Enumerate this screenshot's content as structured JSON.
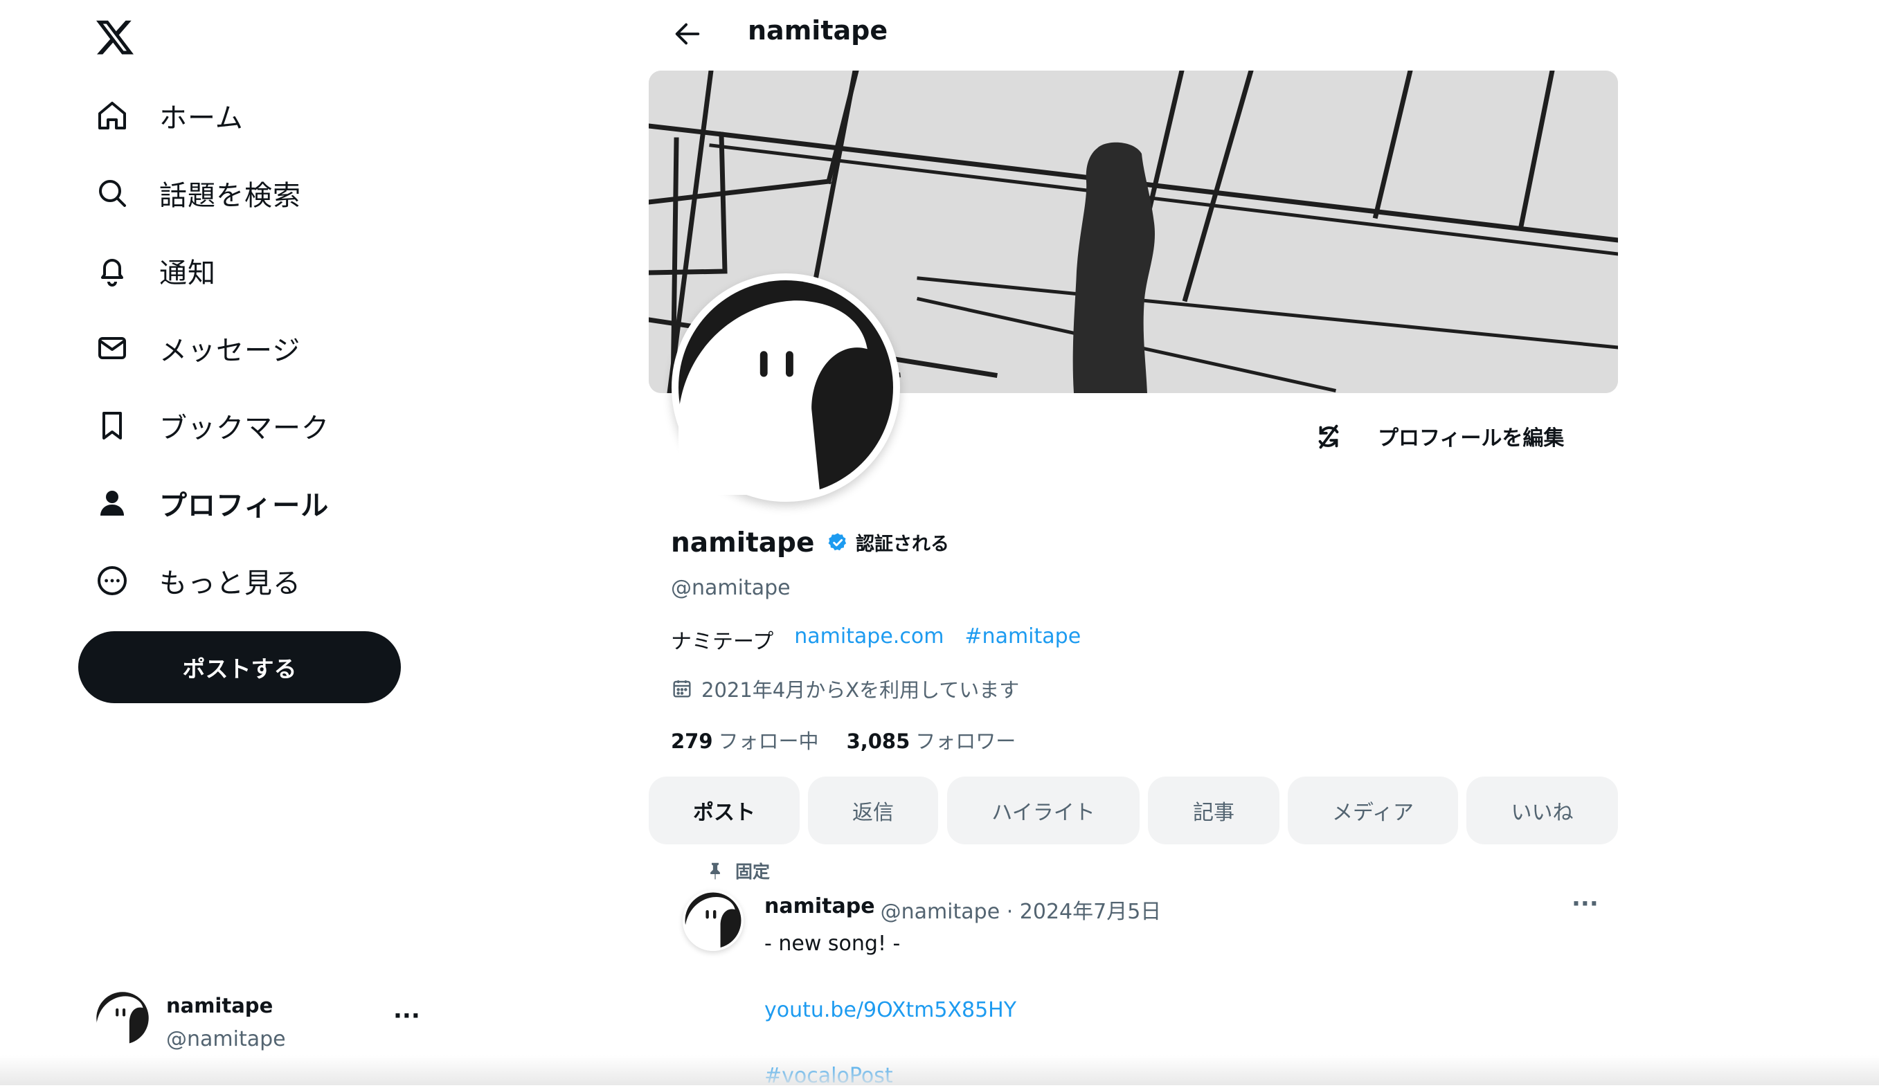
{
  "sidebar": {
    "items": [
      {
        "label": "ホーム",
        "icon": "home-icon"
      },
      {
        "label": "話題を検索",
        "icon": "search-icon"
      },
      {
        "label": "通知",
        "icon": "bell-icon"
      },
      {
        "label": "メッセージ",
        "icon": "envelope-icon"
      },
      {
        "label": "ブックマーク",
        "icon": "bookmark-icon"
      },
      {
        "label": "プロフィール",
        "icon": "person-icon",
        "active": true
      },
      {
        "label": "もっと見る",
        "icon": "more-circle-icon"
      }
    ],
    "post_button": "ポストする",
    "account": {
      "name": "namitape",
      "handle": "@namitape",
      "more": "···"
    }
  },
  "header": {
    "title": "namitape"
  },
  "profile": {
    "edit_button": "プロフィールを編集",
    "name": "namitape",
    "verified_label": "認証される",
    "handle": "@namitape",
    "bio": {
      "text": "ナミテープ",
      "link": "namitape.com",
      "hashtag": "#namitape"
    },
    "joined": "2021年4月からXを利用しています",
    "following_count": "279",
    "following_label": "フォロー中",
    "followers_count": "3,085",
    "followers_label": "フォロワー"
  },
  "tabs": [
    "ポスト",
    "返信",
    "ハイライト",
    "記事",
    "メディア",
    "いいね"
  ],
  "pinned_post": {
    "pinned_label": "固定",
    "author": "namitape",
    "meta": "@namitape · 2024年7月5日",
    "more": "···",
    "line1": "- new song! -",
    "link": "youtu.be/9OXtm5X85HY",
    "hashtag": "#vocaloPost"
  },
  "colors": {
    "link": "#1d9bf0",
    "text": "#0f1419",
    "muted": "#536471",
    "button": "#0f1419",
    "verified": "#1d9bf0"
  }
}
